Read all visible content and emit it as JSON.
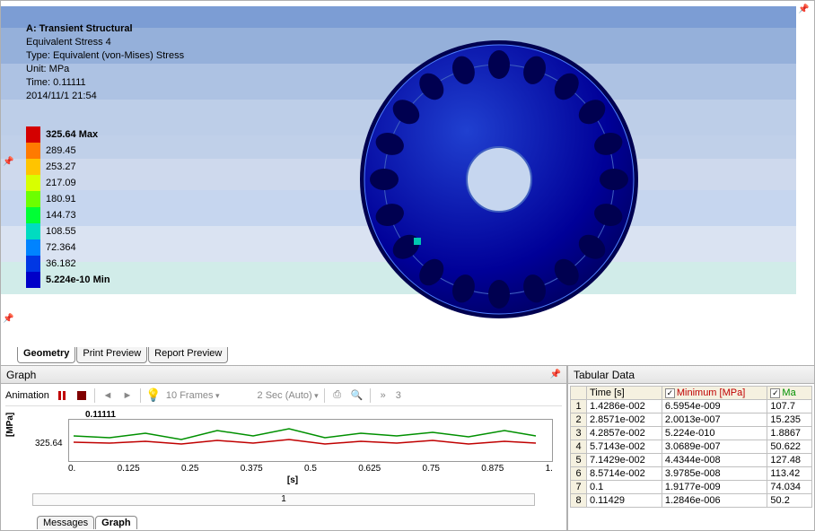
{
  "info": {
    "title": "A: Transient Structural",
    "result_name": "Equivalent Stress 4",
    "type": "Type: Equivalent (von-Mises) Stress",
    "unit": "Unit: MPa",
    "time": "Time: 0.11111",
    "date": "2014/11/1 21:54"
  },
  "legend": [
    {
      "color": "#d40000",
      "label": "325.64 Max",
      "bold": true
    },
    {
      "color": "#ff7a00",
      "label": "289.45"
    },
    {
      "color": "#ffc400",
      "label": "253.27"
    },
    {
      "color": "#d8ff00",
      "label": "217.09"
    },
    {
      "color": "#6cff00",
      "label": "180.91"
    },
    {
      "color": "#00ff35",
      "label": "144.73"
    },
    {
      "color": "#00dcc0",
      "label": "108.55"
    },
    {
      "color": "#0083ff",
      "label": "72.364"
    },
    {
      "color": "#0037e4",
      "label": "36.182"
    },
    {
      "color": "#0000c8",
      "label": "5.224e-10 Min",
      "bold": true
    }
  ],
  "tabs": {
    "geometry": "Geometry",
    "print_preview": "Print Preview",
    "report_preview": "Report Preview"
  },
  "graph": {
    "title": "Graph",
    "animation_label": "Animation",
    "frames": "10 Frames",
    "duration": "2 Sec (Auto)",
    "overflow_count": "3",
    "marker": "0.11111",
    "ylabel": "[MPa]",
    "ymax": "325.64",
    "xlabel": "[s]",
    "xticks": [
      "0.",
      "0.125",
      "0.25",
      "0.375",
      "0.5",
      "0.625",
      "0.75",
      "0.875",
      "1."
    ],
    "slider_val": "1",
    "bottom_tabs": {
      "messages": "Messages",
      "graph": "Graph"
    }
  },
  "tabular": {
    "title": "Tabular Data",
    "headers": {
      "time": "Time [s]",
      "min": "Minimum [MPa]",
      "max": "Ma"
    },
    "rows": [
      {
        "n": "1",
        "time": "1.4286e-002",
        "min": "6.5954e-009",
        "max": "107.7"
      },
      {
        "n": "2",
        "time": "2.8571e-002",
        "min": "2.0013e-007",
        "max": "15.235"
      },
      {
        "n": "3",
        "time": "4.2857e-002",
        "min": "5.224e-010",
        "max": "1.8867"
      },
      {
        "n": "4",
        "time": "5.7143e-002",
        "min": "3.0689e-007",
        "max": "50.622"
      },
      {
        "n": "5",
        "time": "7.1429e-002",
        "min": "4.4344e-008",
        "max": "127.48"
      },
      {
        "n": "6",
        "time": "8.5714e-002",
        "min": "3.9785e-008",
        "max": "113.42"
      },
      {
        "n": "7",
        "time": "0.1",
        "min": "1.9177e-009",
        "max": "74.034"
      },
      {
        "n": "8",
        "time": "0.11429",
        "min": "1.2846e-006",
        "max": "50.2"
      }
    ]
  },
  "chart_data": {
    "type": "line",
    "title": "Equivalent Stress vs Time",
    "xlabel": "[s]",
    "ylabel": "[MPa]",
    "xlim": [
      0,
      1
    ],
    "ylim": [
      0,
      325.64
    ],
    "series": [
      {
        "name": "Maximum",
        "color": "green"
      },
      {
        "name": "Minimum",
        "color": "red"
      }
    ],
    "x": [
      0.014286,
      0.028571,
      0.042857,
      0.057143,
      0.071429,
      0.085714,
      0.1,
      0.11429
    ]
  }
}
